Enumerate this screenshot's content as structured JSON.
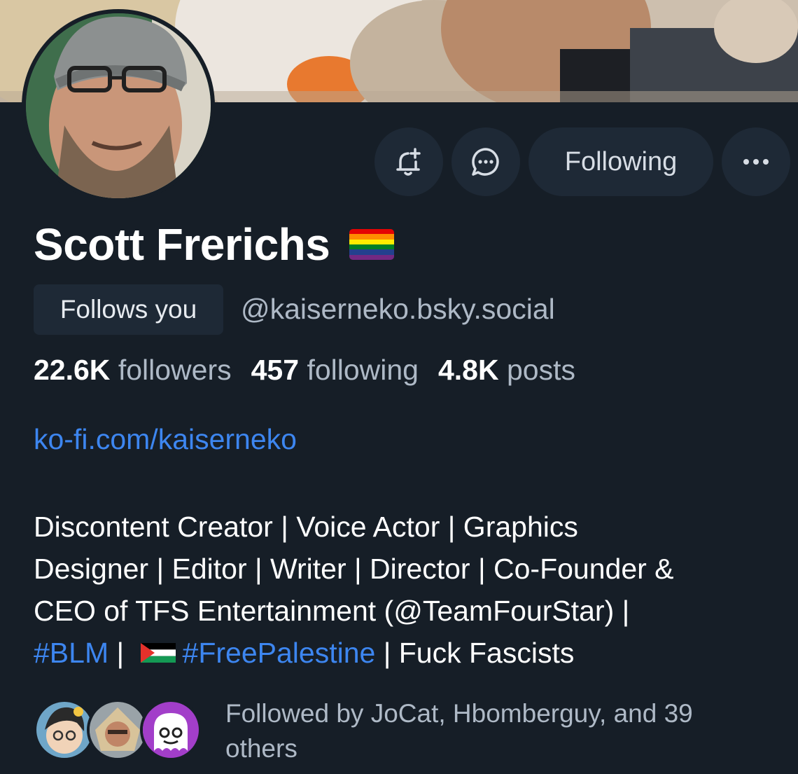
{
  "profile": {
    "name": "Scott Frerichs",
    "follows_you": "Follows you",
    "handle": "@kaiserneko.bsky.social",
    "followers_count": "22.6K",
    "followers_label": "followers",
    "following_count": "457",
    "following_label": "following",
    "posts_count": "4.8K",
    "posts_label": "posts",
    "link": "ko-fi.com/kaiserneko",
    "bio": {
      "line1": "Discontent Creator | Voice Actor | Graphics",
      "line2": "Designer | Editor | Writer | Director | Co-Founder &",
      "line3": "CEO of TFS Entertainment (@TeamFourStar) |",
      "tag_blm": "#BLM",
      "sep1": " | ",
      "tag_palestine": "#FreePalestine",
      "line4_end": " | Fuck Fascists"
    },
    "followed_by": "Followed by JoCat, Hbomberguy, and 39 others"
  },
  "actions": {
    "follow_state": "Following",
    "notify_icon": "bell-plus-icon",
    "message_icon": "chat-bubble-icon",
    "more_icon": "ellipsis-icon"
  },
  "colors": {
    "background": "#161e27",
    "button_bg": "#1e2936",
    "link": "#3d86f0",
    "muted": "#aeb9c6"
  }
}
